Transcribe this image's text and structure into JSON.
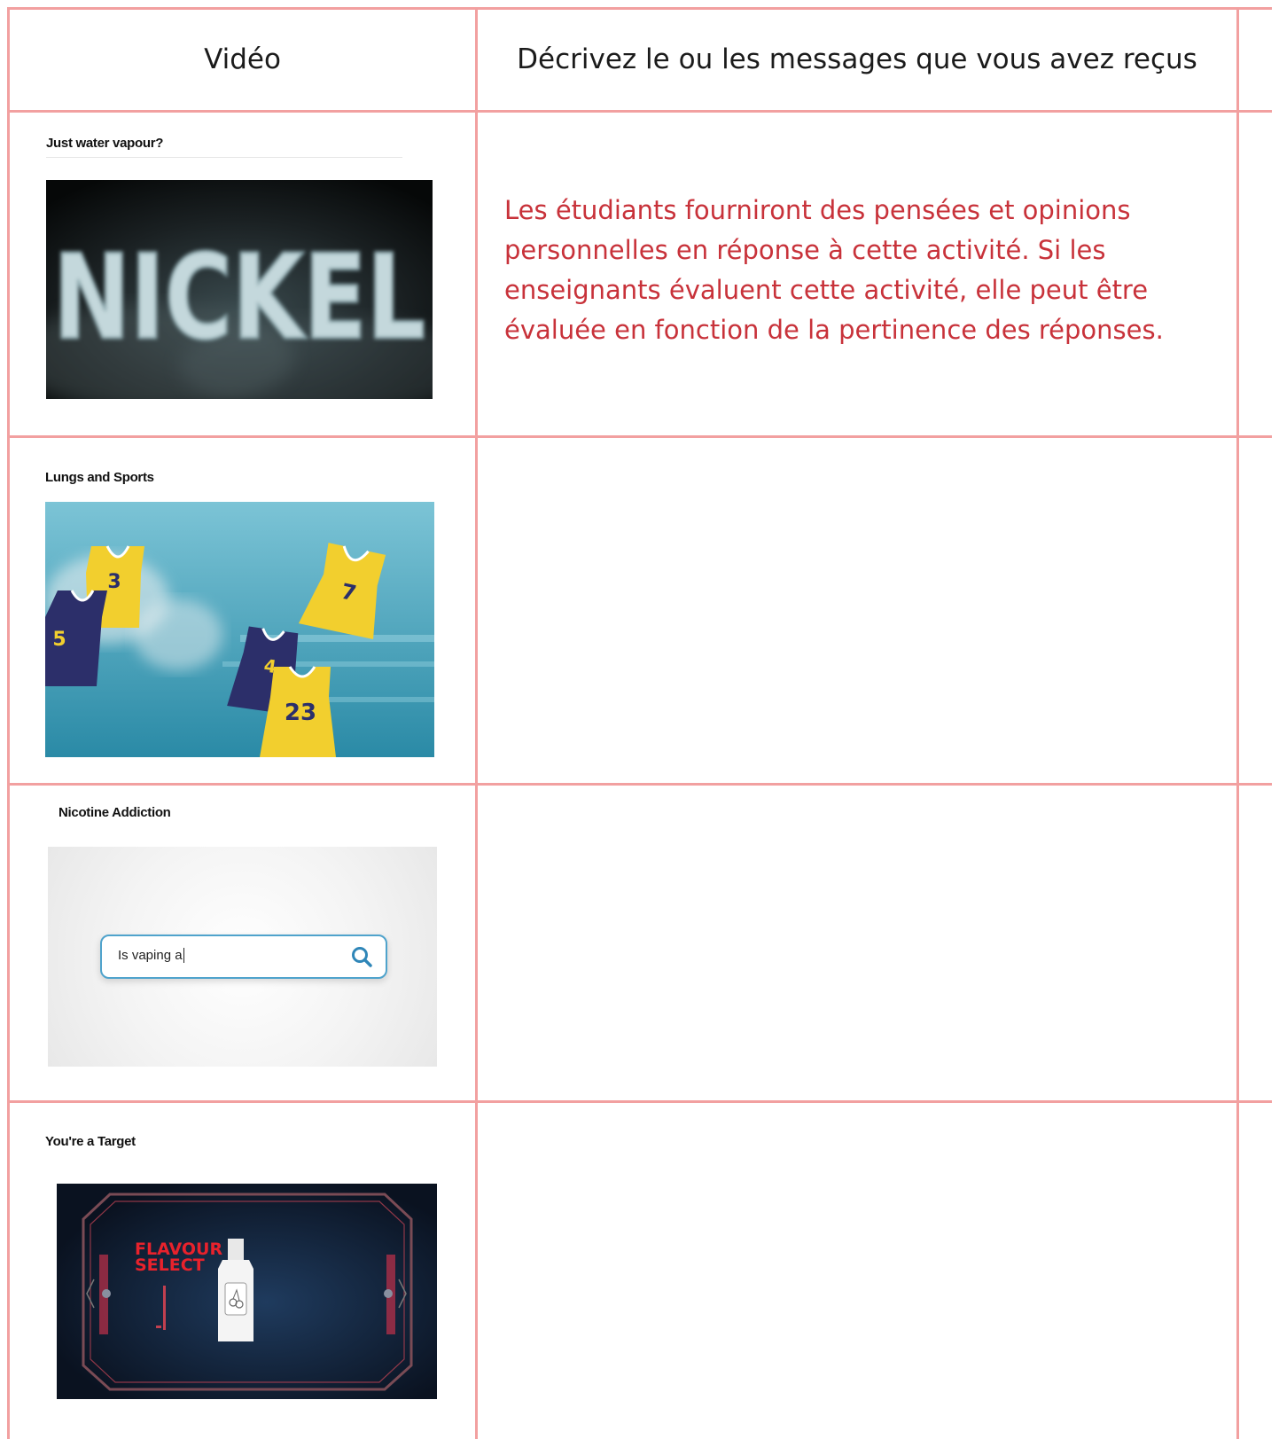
{
  "header": {
    "col1": "Vidéo",
    "col2": "Décrivez le ou les messages que vous avez reçus"
  },
  "rows": [
    {
      "title": "Just water vapour?",
      "thumbnail_text": "NICKEL",
      "answer": "Les étudiants fourniront des pensées et opinions personnelles en réponse à cette activité. Si les enseignants évaluent cette activité, elle peut être évaluée en fonction de la pertinence des réponses."
    },
    {
      "title": "Lungs and Sports",
      "jerseys": [
        "3",
        "5",
        "7",
        "4",
        "23"
      ],
      "answer": ""
    },
    {
      "title": "Nicotine Addiction",
      "search_text": "Is vaping a",
      "search_icon": "search-icon",
      "answer": ""
    },
    {
      "title": "You're a Target",
      "flavour_line1": "FLAVOUR",
      "flavour_line2": "SELECT",
      "answer": ""
    }
  ],
  "colors": {
    "border": "#f2a0a0",
    "answer_text": "#c8323a"
  }
}
